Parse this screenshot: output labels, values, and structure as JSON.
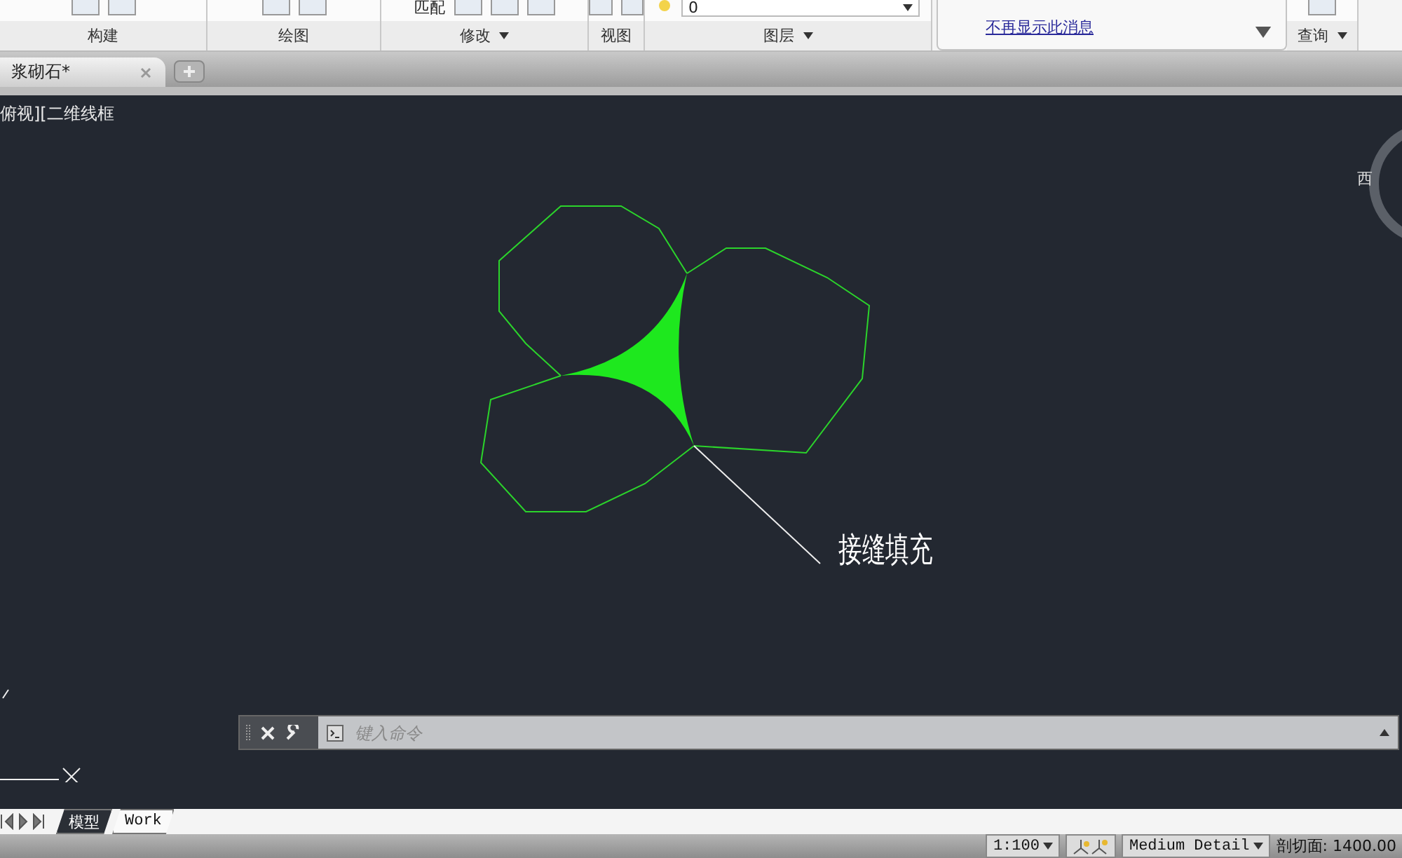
{
  "ribbon": {
    "panels": [
      {
        "label": "构建",
        "has_menu": false
      },
      {
        "label": "绘图",
        "has_menu": false
      },
      {
        "label": "修改",
        "has_menu": true,
        "button_text": "匹配"
      },
      {
        "label": "视图",
        "has_menu": false
      },
      {
        "label": "图层",
        "has_menu": true,
        "layer_value": "0"
      }
    ],
    "notice": {
      "link": "不再显示此消息"
    },
    "query": {
      "label": "查询",
      "has_menu": true
    }
  },
  "document_tabs": [
    {
      "label": "浆砌石*",
      "selected": true
    }
  ],
  "viewport": {
    "label": "俯视][二维线框",
    "annotation": "接缝填充",
    "viewcube_label": "西"
  },
  "command_line": {
    "placeholder": "键入命令"
  },
  "layout_tabs": [
    {
      "label": "模型",
      "selected": true
    },
    {
      "label": "Work",
      "selected": false
    }
  ],
  "status_bar": {
    "scale": "1:100",
    "detail": "Medium Detail",
    "cut_plane": "剖切面: 1400.00"
  }
}
